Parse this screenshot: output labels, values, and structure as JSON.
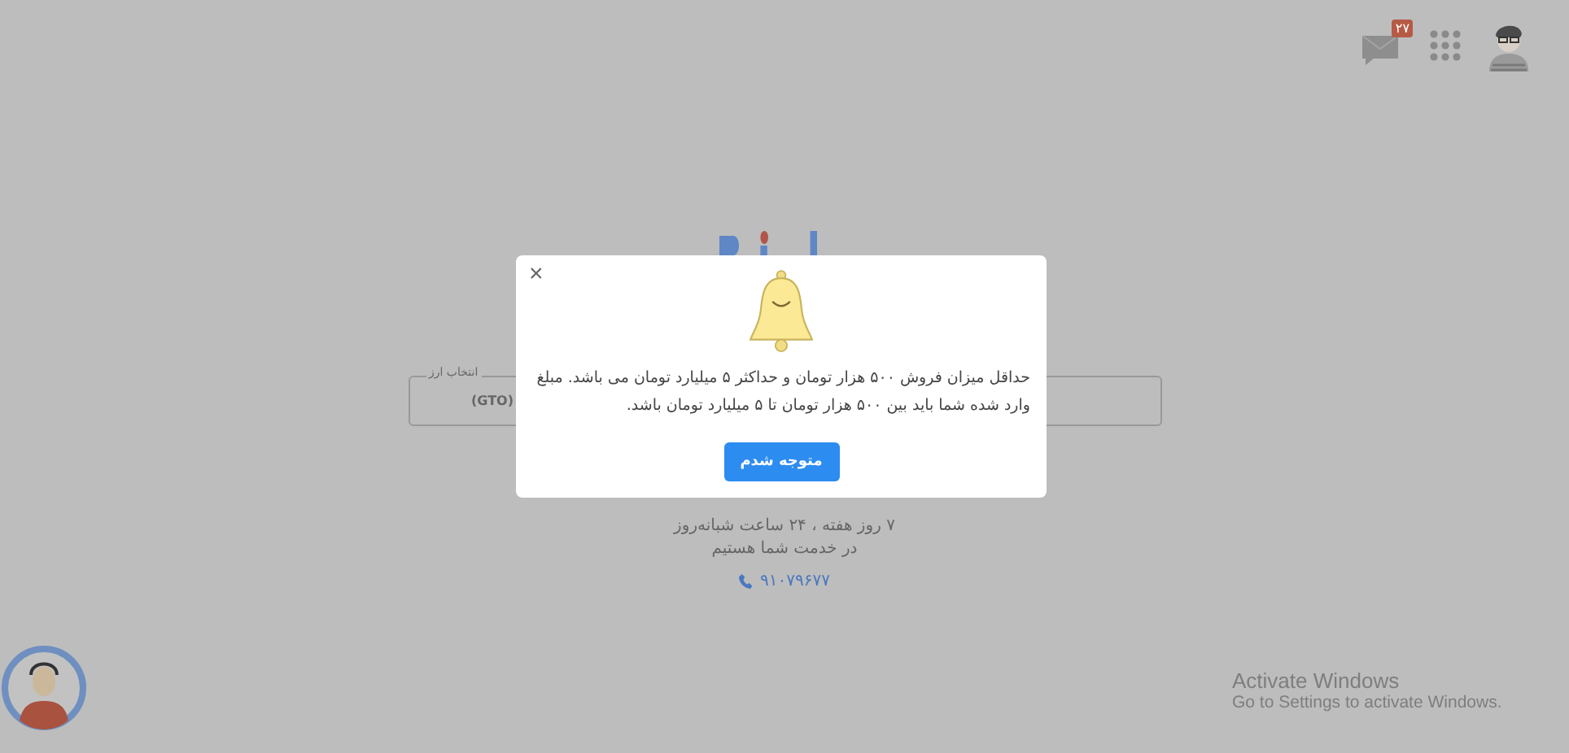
{
  "header": {
    "message_badge": "۲۷"
  },
  "currency_field": {
    "label": "انتخاب ارز",
    "value": "(GTO)"
  },
  "support_text": [
    "۷ روز هفته ، ۲۴ ساعت شبانه‌روز",
    "در خدمت شما هستیم"
  ],
  "phone": "۹۱۰۷۹۶۷۷",
  "dialog": {
    "message": "حداقل میزان فروش ۵۰۰ هزار تومان و حداکثر ۵ میلیارد تومان می باشد. مبلغ وارد شده شما باید بین ۵۰۰ هزار تومان تا ۵ میلیارد تومان باشد.",
    "close": "×",
    "button": "متوجه شدم"
  },
  "os_notice": {
    "title": "Activate Windows",
    "subtitle": "Go to Settings to activate Windows."
  }
}
